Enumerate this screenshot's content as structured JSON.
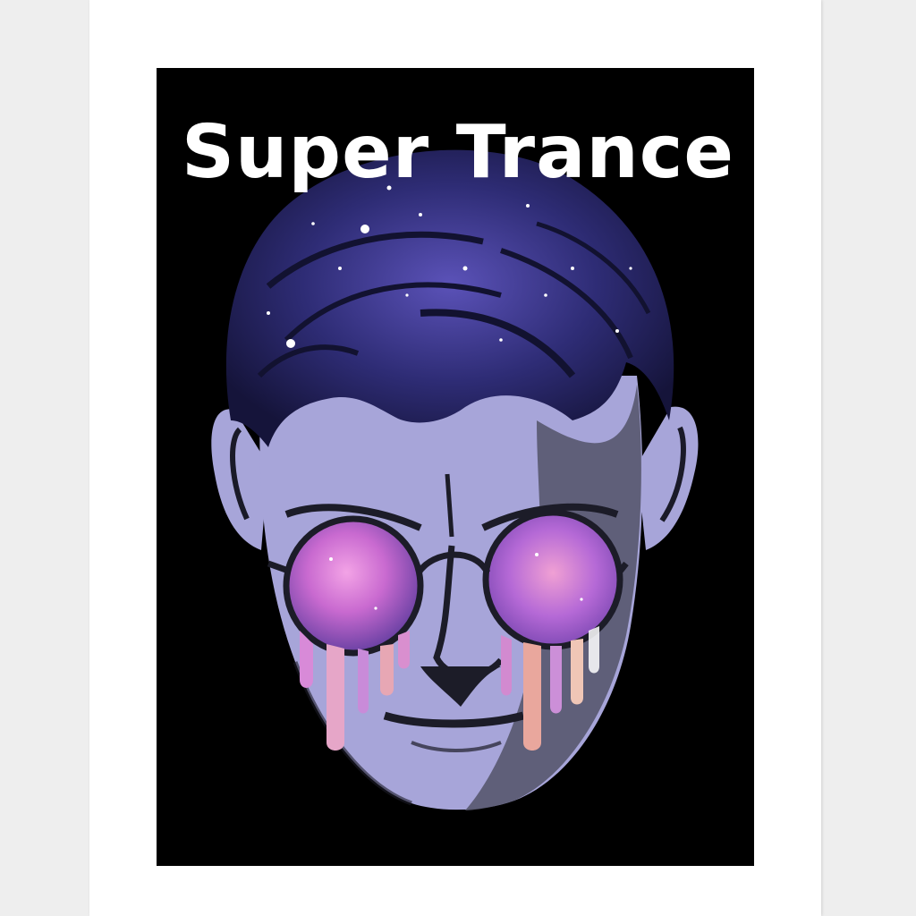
{
  "poster": {
    "title": "Super Trance",
    "colors": {
      "mat": "#ffffff",
      "background": "#000000",
      "title": "#ffffff",
      "skin": "#a7a5d9",
      "skin_shadow": "#55556a",
      "hair": "#2b2b6b",
      "galaxy_pink": "#e07ad6",
      "galaxy_purple": "#8b5fd1"
    },
    "illustration": {
      "subject": "man-face-with-galaxy-hair-and-round-sunglasses",
      "icons": [
        "face-icon",
        "galaxy-hair-icon",
        "sunglasses-icon",
        "drip-icon",
        "star-icon"
      ]
    }
  }
}
